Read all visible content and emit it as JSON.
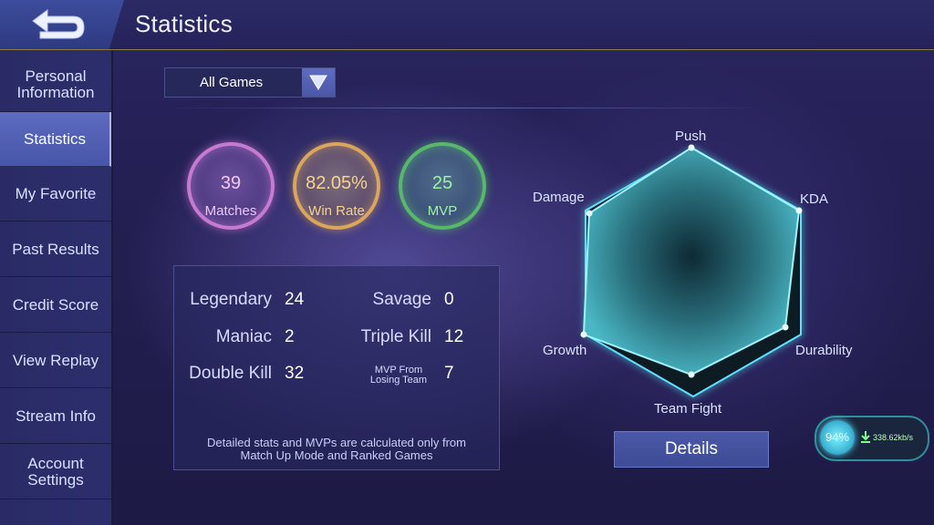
{
  "header": {
    "title": "Statistics"
  },
  "sidebar": {
    "items": [
      {
        "label": "Personal Information"
      },
      {
        "label": "Statistics"
      },
      {
        "label": "My Favorite"
      },
      {
        "label": "Past Results"
      },
      {
        "label": "Credit Score"
      },
      {
        "label": "View Replay"
      },
      {
        "label": "Stream Info"
      },
      {
        "label": "Account Settings"
      }
    ],
    "active_index": 1
  },
  "filter": {
    "selected": "All Games"
  },
  "summary": {
    "matches": {
      "value": "39",
      "label": "Matches"
    },
    "win_rate": {
      "value": "82.05%",
      "label": "Win Rate"
    },
    "mvp": {
      "value": "25",
      "label": "MVP"
    }
  },
  "stats": {
    "legendary": {
      "label": "Legendary",
      "value": "24"
    },
    "savage": {
      "label": "Savage",
      "value": "0"
    },
    "maniac": {
      "label": "Maniac",
      "value": "2"
    },
    "triple_kill": {
      "label": "Triple Kill",
      "value": "12"
    },
    "double_kill": {
      "label": "Double Kill",
      "value": "32"
    },
    "mvp_losing": {
      "label_line1": "MVP From",
      "label_line2": "Losing Team",
      "value": "7"
    },
    "note_line1": "Detailed stats and MVPs are calculated only from",
    "note_line2": "Match Up Mode and Ranked Games"
  },
  "radar": {
    "axes": [
      "Push",
      "KDA",
      "Durability",
      "Team Fight",
      "Growth",
      "Damage"
    ]
  },
  "details_button": {
    "label": "Details"
  },
  "net_widget": {
    "percent": "94%",
    "speed": "338.62kb/s"
  },
  "colors": {
    "matches": "#c67bd0",
    "win_rate": "#d9a65a",
    "mvp": "#58b86a",
    "radar_fill": "#3e8f9c",
    "accent": "#4a58a8"
  }
}
